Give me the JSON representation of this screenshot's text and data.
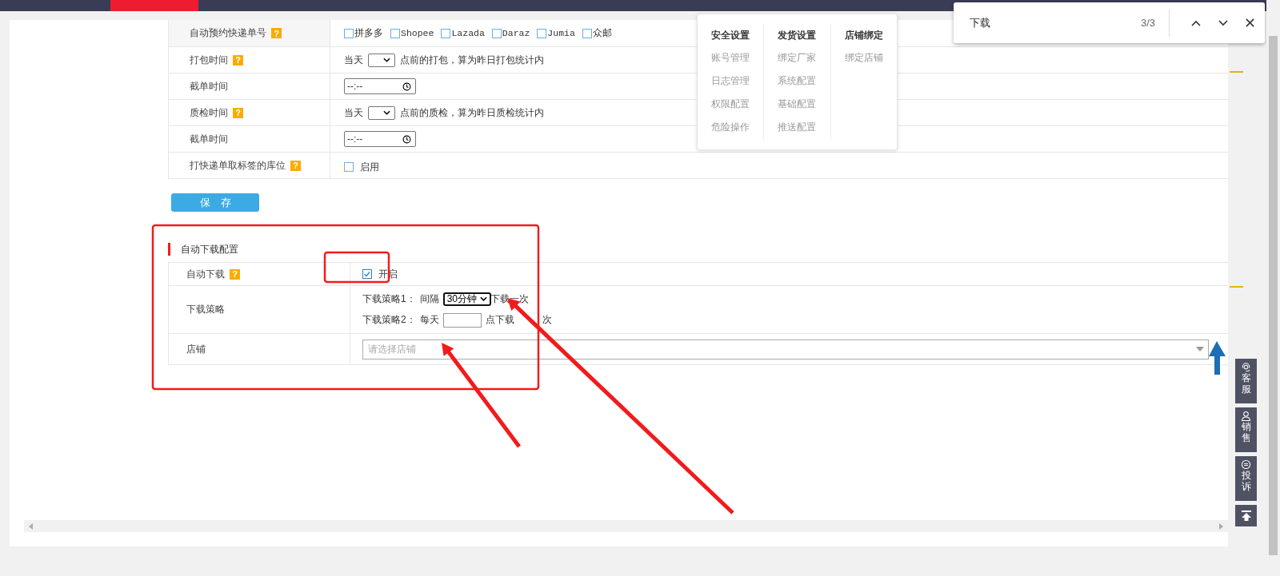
{
  "settings_rows": [
    {
      "kind": "checkbox_group",
      "label": "自动预约快递单号",
      "help": "?",
      "options": [
        {
          "label": "拼多多",
          "checked": false
        },
        {
          "label": "Shopee",
          "checked": false
        },
        {
          "label": "Lazada",
          "checked": false
        },
        {
          "label": "Daraz",
          "checked": false
        },
        {
          "label": "Jumia",
          "checked": false
        },
        {
          "label": "众邮",
          "checked": false
        }
      ]
    },
    {
      "kind": "select_text",
      "label": "打包时间",
      "help": "?",
      "prefix": "当天",
      "suffix": "点前的打包，算为昨日打包统计内"
    },
    {
      "kind": "time",
      "label": "截单时间",
      "value": "--:--"
    },
    {
      "kind": "select_text",
      "label": "质检时间",
      "help": "?",
      "prefix": "当天",
      "suffix": "点前的质检，算为昨日质检统计内"
    },
    {
      "kind": "time",
      "label": "截单时间",
      "value": "--:--"
    },
    {
      "kind": "checkbox",
      "label": "打快递单取标签的库位",
      "help": "?",
      "option": {
        "label": "启用",
        "checked": false
      }
    }
  ],
  "save_button": "保　存",
  "auto_download": {
    "title": "自动下载配置",
    "rows": [
      {
        "kind": "checkbox",
        "label": "自动下载",
        "help": "?",
        "option": {
          "label": "开启",
          "checked": true
        }
      },
      {
        "kind": "strategy",
        "label": "下载策略",
        "lines": [
          {
            "label": "下载策略1：",
            "prefix": "间隔",
            "value": "30分钟",
            "suffix": "下载一次"
          },
          {
            "label": "下载策略2：",
            "prefix": "每天",
            "suffix": "点下载",
            "suffix_tail": "次"
          }
        ]
      },
      {
        "kind": "shop_select",
        "label": "店铺",
        "placeholder": "请选择店铺"
      }
    ]
  },
  "settings_menu": [
    {
      "title": "安全设置",
      "items": [
        "账号管理",
        "日志管理",
        "权限配置",
        "危险操作"
      ]
    },
    {
      "title": "发货设置",
      "items": [
        "绑定厂家",
        "系统配置",
        "基础配置",
        "推送配置"
      ]
    },
    {
      "title": "店铺绑定",
      "items": [
        "绑定店铺"
      ]
    }
  ],
  "find_bar": {
    "query": "下载",
    "count": "3/3"
  },
  "side_buttons": [
    {
      "kind": "service",
      "label": "客服"
    },
    {
      "kind": "sales",
      "label": "销售"
    },
    {
      "kind": "complaint",
      "label": "投诉"
    },
    {
      "kind": "top"
    }
  ]
}
